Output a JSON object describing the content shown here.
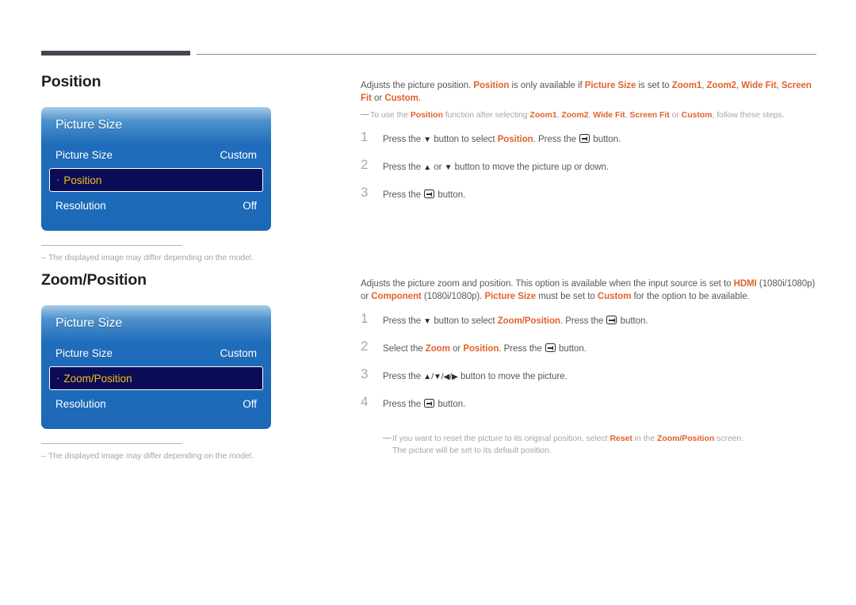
{
  "page": {
    "header_rule_color": "#464451",
    "header_line_color": "#8e8e93",
    "accent_color": "#e2622b",
    "osd_panel_blue": "#1b69b8",
    "osd_selected_navy": "#0b0b56",
    "osd_selected_text": "#f3c11c"
  },
  "sections": [
    {
      "id": "position",
      "title": "Position",
      "osd": {
        "panel_title": "Picture Size",
        "rows": [
          {
            "label": "Picture Size",
            "value": "Custom",
            "selected": false,
            "bullet": ""
          },
          {
            "label": "Position",
            "value": "",
            "selected": true,
            "bullet": "·"
          },
          {
            "label": "Resolution",
            "value": "Off",
            "selected": false,
            "bullet": ""
          }
        ]
      },
      "footnote": {
        "dash": "–",
        "text": "The displayed image may differ depending on the model."
      },
      "intro": {
        "parts": [
          {
            "t": "Adjusts the picture position. ",
            "em": false
          },
          {
            "t": "Position",
            "em": true
          },
          {
            "t": " is only available if ",
            "em": false
          },
          {
            "t": "Picture Size",
            "em": true
          },
          {
            "t": " is set to ",
            "em": false
          },
          {
            "t": "Zoom1",
            "em": true
          },
          {
            "t": ", ",
            "em": false
          },
          {
            "t": "Zoom2",
            "em": true
          },
          {
            "t": ", ",
            "em": false
          },
          {
            "t": "Wide Fit",
            "em": true
          },
          {
            "t": ", ",
            "em": false
          },
          {
            "t": "Screen Fit",
            "em": true
          },
          {
            "t": " or ",
            "em": false
          },
          {
            "t": "Custom",
            "em": true
          },
          {
            "t": ".",
            "em": false
          }
        ]
      },
      "note": {
        "dash": "—",
        "parts": [
          {
            "t": "To use the ",
            "em": false
          },
          {
            "t": "Position",
            "em": true
          },
          {
            "t": " function after selecting ",
            "em": false
          },
          {
            "t": "Zoom1",
            "em": true
          },
          {
            "t": ", ",
            "em": false
          },
          {
            "t": "Zoom2",
            "em": true
          },
          {
            "t": ", ",
            "em": false
          },
          {
            "t": "Wide Fit",
            "em": true
          },
          {
            "t": ", ",
            "em": false
          },
          {
            "t": "Screen Fit",
            "em": true
          },
          {
            "t": " or ",
            "em": false
          },
          {
            "t": "Custom",
            "em": true
          },
          {
            "t": ", follow these steps.",
            "em": false
          }
        ]
      },
      "steps": [
        {
          "num": "1",
          "parts": [
            {
              "t": "Press the ",
              "em": false
            },
            {
              "t": "▼",
              "arrow": true
            },
            {
              "t": " button to select ",
              "em": false
            },
            {
              "t": "Position",
              "em": true
            },
            {
              "t": ". Press the ",
              "em": false
            },
            {
              "t": "",
              "enter": true
            },
            {
              "t": " button.",
              "em": false
            }
          ]
        },
        {
          "num": "2",
          "parts": [
            {
              "t": "Press the ",
              "em": false
            },
            {
              "t": "▲",
              "arrow": true
            },
            {
              "t": " or ",
              "em": false
            },
            {
              "t": "▼",
              "arrow": true
            },
            {
              "t": " button to move the picture up or down.",
              "em": false
            }
          ]
        },
        {
          "num": "3",
          "parts": [
            {
              "t": "Press the ",
              "em": false
            },
            {
              "t": "",
              "enter": true
            },
            {
              "t": " button.",
              "em": false
            }
          ]
        }
      ],
      "sub_note": null
    },
    {
      "id": "zoomposition",
      "title": "Zoom/Position",
      "osd": {
        "panel_title": "Picture Size",
        "rows": [
          {
            "label": "Picture Size",
            "value": "Custom",
            "selected": false,
            "bullet": ""
          },
          {
            "label": "Zoom/Position",
            "value": "",
            "selected": true,
            "bullet": "·"
          },
          {
            "label": "Resolution",
            "value": "Off",
            "selected": false,
            "bullet": ""
          }
        ]
      },
      "footnote": {
        "dash": "–",
        "text": "The displayed image may differ depending on the model."
      },
      "intro": {
        "parts": [
          {
            "t": "Adjusts the picture zoom and position. This option is available when the input source is set to ",
            "em": false
          },
          {
            "t": "HDMI",
            "em": true
          },
          {
            "t": " (1080i/1080p) or ",
            "em": false
          },
          {
            "t": "Component",
            "em": true
          },
          {
            "t": " (1080i/1080p). ",
            "em": false
          },
          {
            "t": "Picture Size",
            "em": true
          },
          {
            "t": " must be set to ",
            "em": false
          },
          {
            "t": "Custom",
            "em": true
          },
          {
            "t": " for the option to be available.",
            "em": false
          }
        ]
      },
      "note": null,
      "steps": [
        {
          "num": "1",
          "parts": [
            {
              "t": "Press the ",
              "em": false
            },
            {
              "t": "▼",
              "arrow": true
            },
            {
              "t": " button to select ",
              "em": false
            },
            {
              "t": "Zoom/Position",
              "em": true
            },
            {
              "t": ". Press the ",
              "em": false
            },
            {
              "t": "",
              "enter": true
            },
            {
              "t": " button.",
              "em": false
            }
          ]
        },
        {
          "num": "2",
          "parts": [
            {
              "t": "Select the ",
              "em": false
            },
            {
              "t": "Zoom",
              "em": true
            },
            {
              "t": " or ",
              "em": false
            },
            {
              "t": "Position",
              "em": true
            },
            {
              "t": ". Press the ",
              "em": false
            },
            {
              "t": "",
              "enter": true
            },
            {
              "t": " button.",
              "em": false
            }
          ]
        },
        {
          "num": "3",
          "parts": [
            {
              "t": "Press the ",
              "em": false
            },
            {
              "t": "▲/▼/◀/▶",
              "arrow": true
            },
            {
              "t": " button to move the picture.",
              "em": false
            }
          ]
        },
        {
          "num": "4",
          "parts": [
            {
              "t": "Press the ",
              "em": false
            },
            {
              "t": "",
              "enter": true
            },
            {
              "t": " button.",
              "em": false
            }
          ]
        }
      ],
      "sub_note": {
        "dash": "—",
        "parts": [
          {
            "t": "If you want to reset the picture to its original position, select ",
            "em": false
          },
          {
            "t": "Reset",
            "em": true
          },
          {
            "t": " in the ",
            "em": false
          },
          {
            "t": "Zoom/Position",
            "em": true
          },
          {
            "t": " screen.",
            "em": false
          },
          {
            "t": "\n",
            "br": true
          },
          {
            "t": "The picture will be set to its default position.",
            "em": false
          }
        ]
      }
    }
  ]
}
